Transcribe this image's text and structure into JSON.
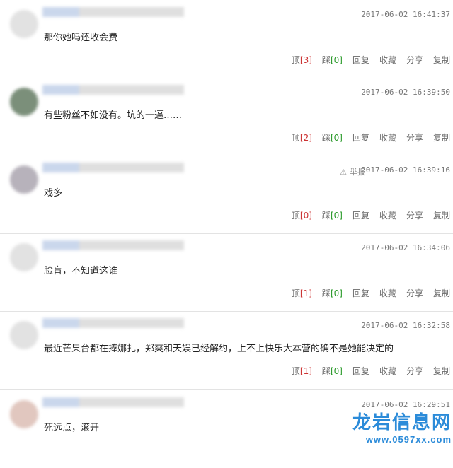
{
  "comments": [
    {
      "time": "2017-06-02 16:41:37",
      "text": "那你她吗还收会费",
      "up": "[3]",
      "down": "[0]",
      "report": ""
    },
    {
      "time": "2017-06-02 16:39:50",
      "text": "有些粉丝不如没有。坑的一逼……",
      "up": "[2]",
      "down": "[0]",
      "report": ""
    },
    {
      "time": "2017-06-02 16:39:16",
      "text": "戏多",
      "up": "[0]",
      "down": "[0]",
      "report": "举报"
    },
    {
      "time": "2017-06-02 16:34:06",
      "text": "脸盲，不知道这谁",
      "up": "[1]",
      "down": "[0]",
      "report": ""
    },
    {
      "time": "2017-06-02 16:32:58",
      "text": "最近芒果台都在捧娜扎，郑爽和天娱已经解约，上不上快乐大本营的确不是她能决定的",
      "up": "[1]",
      "down": "[0]",
      "report": ""
    },
    {
      "time": "2017-06-02 16:29:51",
      "text": "死远点，滚开",
      "up": "",
      "down": "",
      "report": ""
    }
  ],
  "labels": {
    "up": "顶",
    "down": "踩",
    "reply": "回复",
    "fav": "收藏",
    "share": "分享",
    "copy": "复制"
  },
  "watermark": {
    "main": "龙岩信息网",
    "url": "www.0597xx.com"
  }
}
